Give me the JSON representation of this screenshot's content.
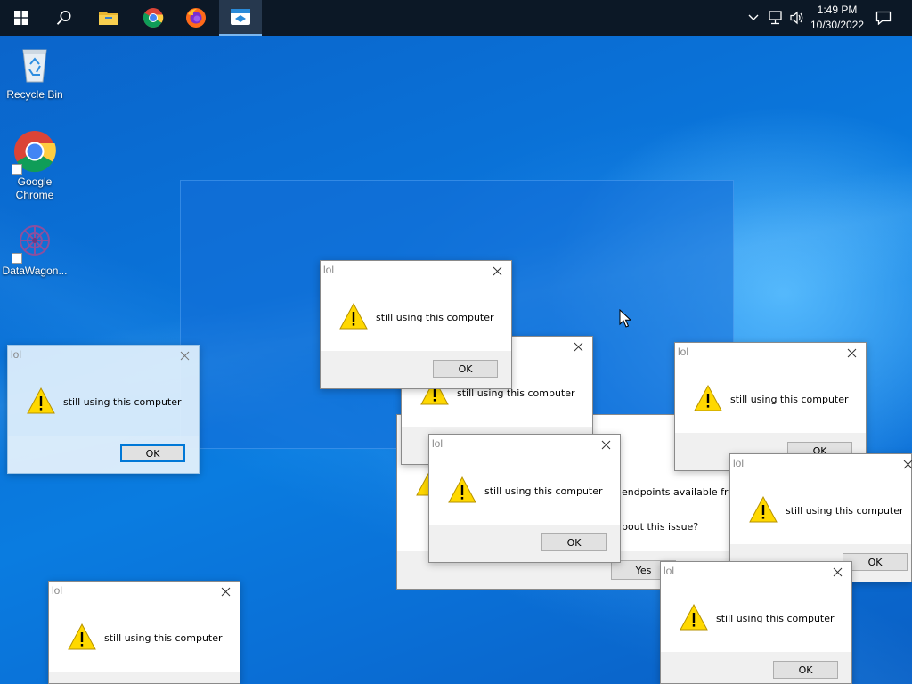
{
  "taskbar": {
    "time": "1:49 PM",
    "date": "10/30/2022",
    "pinned": [
      {
        "name": "start-icon"
      },
      {
        "name": "search-icon"
      },
      {
        "name": "file-explorer-icon"
      },
      {
        "name": "chrome-icon"
      },
      {
        "name": "firefox-icon"
      },
      {
        "name": "datawagon-app-icon",
        "active": true
      }
    ],
    "tray_icons": [
      "chevron-up-icon",
      "network-icon",
      "volume-icon",
      "notification-icon"
    ]
  },
  "desktop": {
    "icons": [
      {
        "label": "Recycle Bin",
        "icon": "recycle-bin-icon"
      },
      {
        "label": "Google Chrome",
        "icon": "chrome-icon"
      },
      {
        "label": "DataWagon...",
        "icon": "datawagon-icon"
      }
    ]
  },
  "question_dialog": {
    "line1": "endpoints available fro",
    "line2": "bout this issue?",
    "yes_label": "Yes"
  },
  "popup": {
    "title": "lol",
    "message": "still using this computer",
    "ok_label": "OK"
  },
  "colors": {
    "taskbar": "#0c1826",
    "accent": "#0078d7",
    "warning_yellow": "#ffd800"
  }
}
